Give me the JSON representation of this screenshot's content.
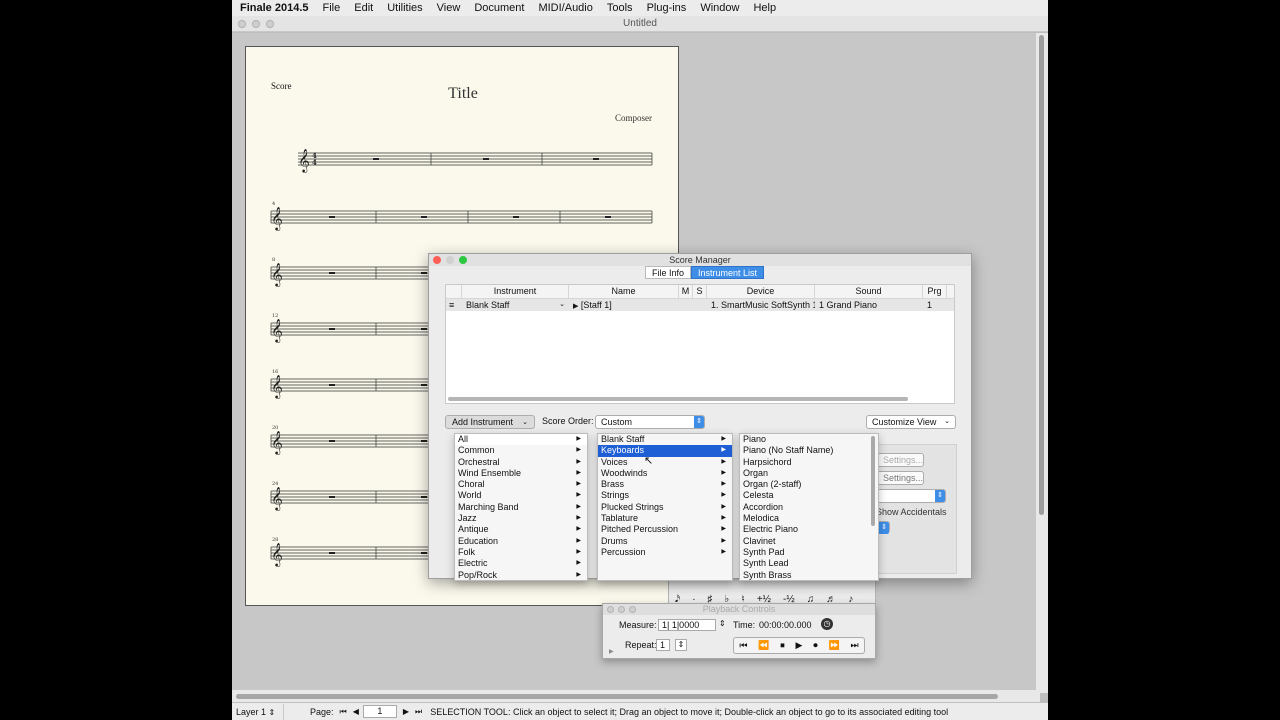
{
  "menubar": {
    "app": "Finale 2014.5",
    "items": [
      "File",
      "Edit",
      "Utilities",
      "View",
      "Document",
      "MIDI/Audio",
      "Tools",
      "Plug-ins",
      "Window",
      "Help"
    ]
  },
  "document": {
    "title": "Untitled"
  },
  "score_page": {
    "label": "Score",
    "title": "Title",
    "composer": "Composer",
    "measure_numbers": [
      "4",
      "8",
      "12",
      "16",
      "20",
      "24",
      "28"
    ]
  },
  "score_manager": {
    "title": "Score Manager",
    "tabs": [
      "File Info",
      "Instrument List"
    ],
    "active_tab": "Instrument List",
    "columns": [
      "Instrument",
      "Name",
      "M",
      "S",
      "Device",
      "Sound",
      "Prg"
    ],
    "rows": [
      {
        "instrument": "Blank Staff",
        "name": "[Staff 1]",
        "device": "1. SmartMusic SoftSynth 1",
        "sound": "1 Grand Piano",
        "prg": "1"
      }
    ],
    "add_instrument": "Add Instrument",
    "score_order_label": "Score Order:",
    "score_order_value": "Custom",
    "customize_view": "Customize View",
    "ghost_settings_1": "Settings...",
    "ghost_settings_2": "Settings...",
    "show_accidentals": "Show Accidentals"
  },
  "menu_categories": [
    "All",
    "Common",
    "Orchestral",
    "Wind Ensemble",
    "Choral",
    "World",
    "Marching Band",
    "Jazz",
    "Antique",
    "Education",
    "Folk",
    "Electric",
    "Pop/Rock"
  ],
  "menu_families": [
    "Blank Staff",
    "Keyboards",
    "Voices",
    "Woodwinds",
    "Brass",
    "Strings",
    "Plucked Strings",
    "Tablature",
    "Pitched Percussion",
    "Drums",
    "Percussion"
  ],
  "menu_families_selected": "Keyboards",
  "menu_instruments": [
    "Piano",
    "Piano (No Staff Name)",
    "Harpsichord",
    "Organ",
    "Organ (2-staff)",
    "Celesta",
    "Accordion",
    "Melodica",
    "Electric Piano",
    "Clavinet",
    "Synth Pad",
    "Synth Lead",
    "Synth Brass"
  ],
  "palette": {
    "glyphs": [
      "𝅘𝅥𝅯",
      "·",
      "♯",
      "♭",
      "♮",
      "+½",
      "-½",
      "♫",
      "♬",
      "♪"
    ]
  },
  "playback": {
    "title": "Playback Controls",
    "measure_label": "Measure:",
    "measure_value": "1| 1|0000",
    "time_label": "Time:",
    "time_value": "00:00:00.000",
    "repeat_label": "Repeat:",
    "repeat_value": "1",
    "transport": [
      "⏮",
      "⏪",
      "⏹",
      "▶",
      "⏺",
      "⏩",
      "⏭"
    ]
  },
  "statusbar": {
    "layer": "Layer 1",
    "page_label": "Page:",
    "page_value": "1",
    "message": "SELECTION TOOL: Click an object to select it; Drag an object to move it; Double-click an object to go to its associated editing tool"
  }
}
